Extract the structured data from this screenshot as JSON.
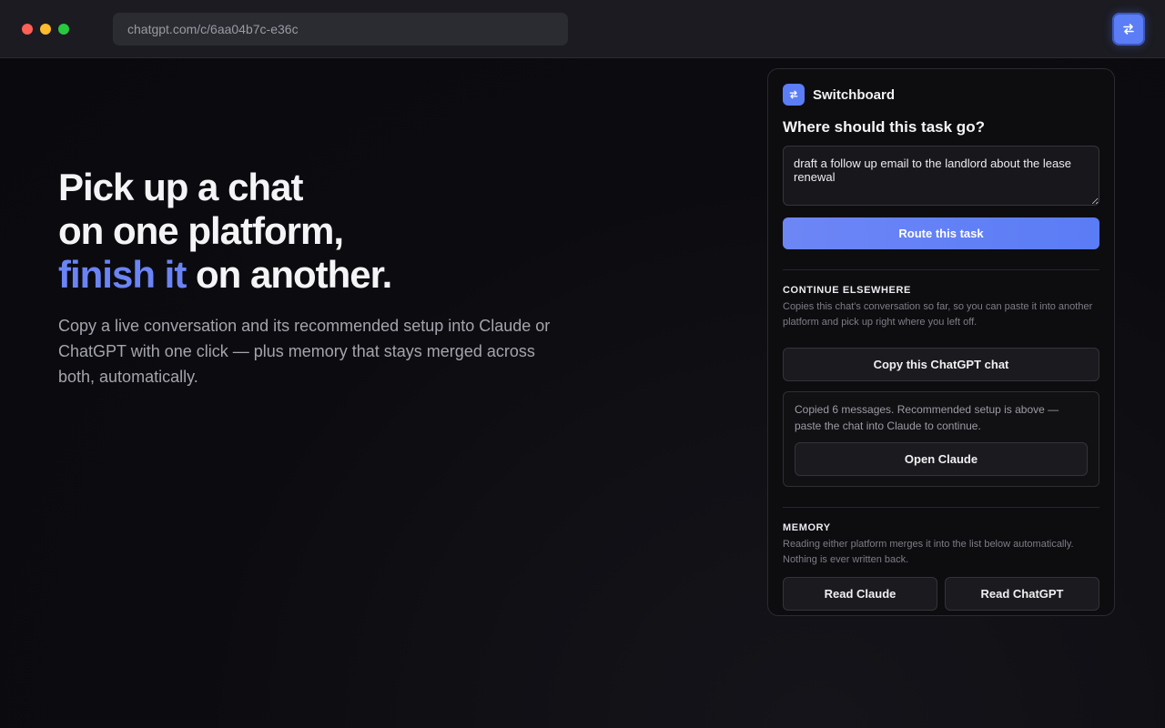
{
  "browser": {
    "url": "chatgpt.com/c/6aa04b7c-e36c",
    "accent": "#5b7df5"
  },
  "hero": {
    "line1": "Pick up a chat",
    "line2": "on one platform,",
    "line3_accent": "finish it",
    "line3_rest": " on another.",
    "subtitle": "Copy a live conversation and its recommended setup into Claude or ChatGPT with one click — plus memory that stays merged across both, automatically."
  },
  "panel": {
    "brand": "Switchboard",
    "question": "Where should this task go?",
    "task_value": "draft a follow up email to the landlord about the lease renewal",
    "route_label": "Route this task",
    "continue": {
      "title": "CONTINUE ELSEWHERE",
      "description": "Copies this chat's conversation so far, so you can paste it into another platform and pick up right where you left off.",
      "copy_label": "Copy this ChatGPT chat",
      "status": "Copied 6 messages. Recommended setup is above — paste the chat into Claude to continue.",
      "open_label": "Open Claude"
    },
    "memory": {
      "title": "MEMORY",
      "description": "Reading either platform merges it into the list below automatically. Nothing is ever written back.",
      "read_claude_label": "Read Claude",
      "read_chatgpt_label": "Read ChatGPT"
    }
  }
}
